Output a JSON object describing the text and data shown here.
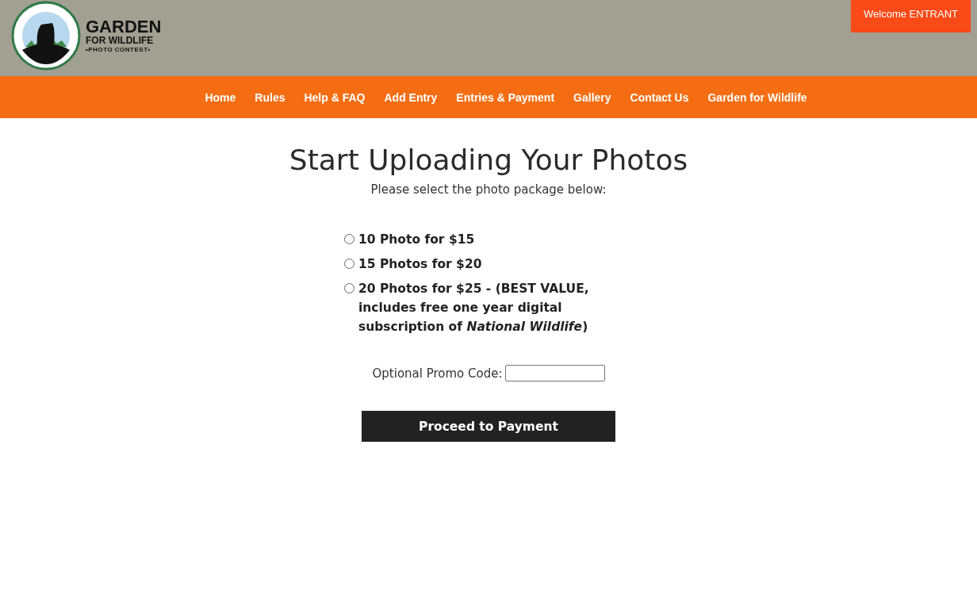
{
  "header": {
    "logo": {
      "title": "GARDEN",
      "subtitle": "FOR WILDLIFE",
      "tagline": "•PHOTO CONTEST•"
    },
    "welcome": "Welcome ENTRANT"
  },
  "nav": [
    {
      "label": "Home"
    },
    {
      "label": "Rules"
    },
    {
      "label": "Help & FAQ"
    },
    {
      "label": "Add Entry"
    },
    {
      "label": "Entries & Payment"
    },
    {
      "label": "Gallery"
    },
    {
      "label": "Contact Us"
    },
    {
      "label": "Garden for Wildlife"
    }
  ],
  "main": {
    "title": "Start Uploading Your Photos",
    "subtitle": "Please select the photo package below:",
    "packages": [
      {
        "label": "10 Photo for $15",
        "selected": false
      },
      {
        "label": "15 Photos for $20",
        "selected": false
      },
      {
        "label": "20 Photos for $25 - (BEST VALUE, includes free one year digital subscription of *National Wildlife*)",
        "selected": false
      }
    ],
    "promo": {
      "label": "Optional Promo Code:"
    },
    "button": "Proceed to Payment"
  }
}
